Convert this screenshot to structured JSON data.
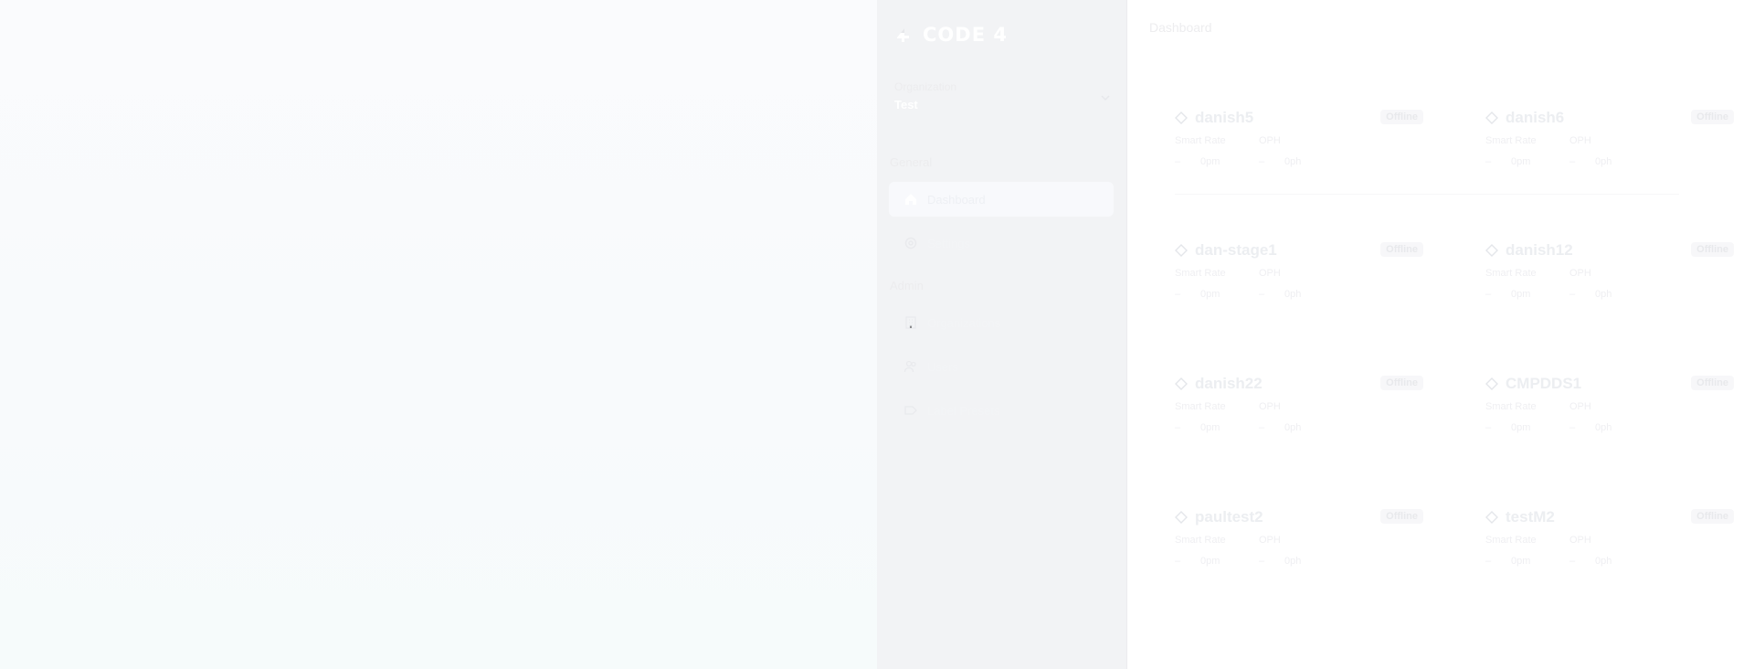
{
  "app": {
    "brand": "CODE 4"
  },
  "sidebar": {
    "organization_label": "Organization",
    "organization_value": "Test",
    "sections": [
      {
        "label": "General",
        "items": [
          {
            "label": "Dashboard",
            "icon": "home-icon",
            "active": true
          },
          {
            "label": "Settings",
            "icon": "gear-icon",
            "active": false
          }
        ]
      },
      {
        "label": "Admin",
        "items": [
          {
            "label": "Organizations",
            "icon": "building-icon",
            "active": false
          },
          {
            "label": "Users",
            "icon": "users-icon",
            "active": false
          },
          {
            "label": "Label Presets",
            "icon": "tag-icon",
            "active": false
          }
        ]
      }
    ]
  },
  "main": {
    "breadcrumb": "Dashboard",
    "machines": [
      {
        "name": "danish5",
        "status": "Offline",
        "col1_label": "Smart Rate",
        "col2_label": "OPH",
        "col1_value": "0pm",
        "col2_value": "0ph"
      },
      {
        "name": "danish6",
        "status": "Offline",
        "col1_label": "Smart Rate",
        "col2_label": "OPH",
        "col1_value": "0pm",
        "col2_value": "0ph"
      },
      {
        "name": "dan-stage1",
        "status": "Offline",
        "col1_label": "Smart Rate",
        "col2_label": "OPH",
        "col1_value": "0pm",
        "col2_value": "0ph"
      },
      {
        "name": "danish12",
        "status": "Offline",
        "col1_label": "Smart Rate",
        "col2_label": "OPH",
        "col1_value": "0pm",
        "col2_value": "0ph"
      },
      {
        "name": "danish22",
        "status": "Offline",
        "col1_label": "Smart Rate",
        "col2_label": "OPH",
        "col1_value": "0pm",
        "col2_value": "0ph"
      },
      {
        "name": "CMPDDS1",
        "status": "Offline",
        "col1_label": "Smart Rate",
        "col2_label": "OPH",
        "col1_value": "0pm",
        "col2_value": "0ph"
      },
      {
        "name": "paultest2",
        "status": "Offline",
        "col1_label": "Smart Rate",
        "col2_label": "OPH",
        "col1_value": "0pm",
        "col2_value": "0ph"
      },
      {
        "name": "testM2",
        "status": "Offline",
        "col1_label": "Smart Rate",
        "col2_label": "OPH",
        "col1_value": "0pm",
        "col2_value": "0ph"
      }
    ]
  },
  "colors": {
    "sidebar_bg": "#f2f3f5",
    "active_item_bg": "#f8f9fc",
    "main_bg": "#ffffff"
  }
}
